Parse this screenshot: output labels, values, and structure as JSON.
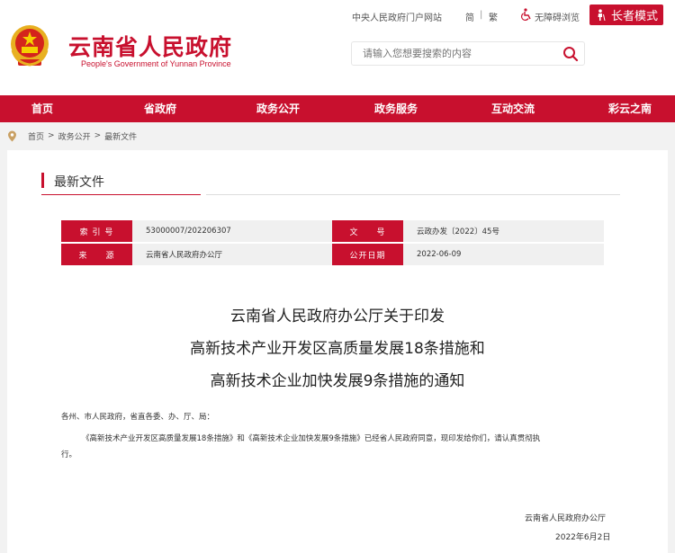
{
  "header": {
    "title_cn": "云南省人民政府",
    "title_en": "People's Government of Yunnan Province",
    "top_links": {
      "central_portal": "中央人民政府门户网站",
      "simplified": "简",
      "divider": "|",
      "traditional": "繁",
      "accessibility": "无障碍浏览"
    },
    "elder_mode_label": "长者模式",
    "search_placeholder": "请输入您想要搜索的内容"
  },
  "nav": {
    "items": [
      "首页",
      "省政府",
      "政务公开",
      "政务服务",
      "互动交流",
      "彩云之南"
    ]
  },
  "breadcrumb": {
    "items": [
      "首页",
      "政务公开",
      "最新文件"
    ],
    "separator": ">"
  },
  "section": {
    "title": "最新文件"
  },
  "meta": {
    "index_label": "索 引 号",
    "index_value": "53000007/202206307",
    "doc_no_label": "文　　号",
    "doc_no_value": "云政办发〔2022〕45号",
    "source_label": "来　　源",
    "source_value": "云南省人民政府办公厅",
    "date_label": "公开日期",
    "date_value": "2022-06-09"
  },
  "document": {
    "title_lines": [
      "云南省人民政府办公厅关于印发",
      "高新技术产业开发区高质量发展18条措施和",
      "高新技术企业加快发展9条措施的通知"
    ],
    "salutation": "各州、市人民政府，省直各委、办、厅、局：",
    "paragraph_line1": "《高新技术产业开发区高质量发展18条措施》和《高新技术企业加快发展9条措施》已经省人民政府同意，现印发给你们，请认真贯彻执",
    "paragraph_line2": "行。",
    "signer": "云南省人民政府办公厅",
    "sign_date": "2022年6月2日"
  },
  "colors": {
    "brand_red": "#c8102e",
    "meta_bg": "#f0f0f0",
    "page_bg": "#f2f2f2"
  },
  "icons": [
    "national-emblem-icon",
    "accessibility-icon",
    "elder-person-icon",
    "search-icon",
    "location-pin-icon"
  ]
}
